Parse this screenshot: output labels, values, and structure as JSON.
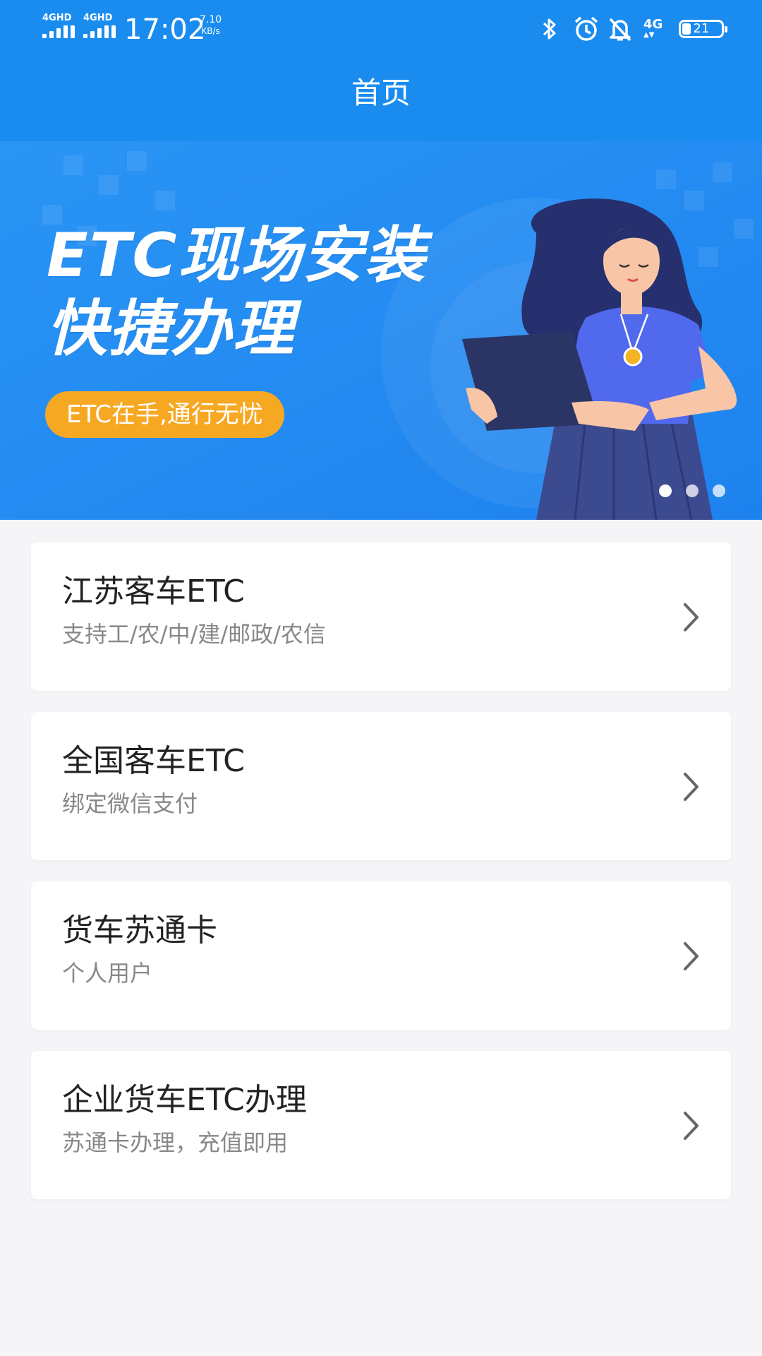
{
  "status_bar": {
    "signal1_label": "4GHD",
    "signal2_label": "4GHD",
    "time": "17:02",
    "net_speed_value": "7.10",
    "net_speed_unit": "KB/s",
    "net_type": "4G",
    "battery": "21",
    "icons": [
      "bluetooth-icon",
      "alarm-icon",
      "mute-icon",
      "4g-icon",
      "battery-icon"
    ]
  },
  "header": {
    "title": "首页"
  },
  "banner": {
    "headline_line1": "ETC现场安装",
    "headline_line2": "快捷办理",
    "tag": "ETC在手,通行无忧",
    "page_count": 3,
    "active_index": 0
  },
  "cards": [
    {
      "title": "江苏客车ETC",
      "subtitle": "支持工/农/中/建/邮政/农信"
    },
    {
      "title": "全国客车ETC",
      "subtitle": "绑定微信支付"
    },
    {
      "title": "货车苏通卡",
      "subtitle": "个人用户"
    },
    {
      "title": "企业货车ETC办理",
      "subtitle": "苏通卡办理，充值即用"
    }
  ],
  "colors": {
    "primary": "#1a8cf0",
    "tag": "#f7a823",
    "background": "#f5f5f7",
    "title_text": "#222222",
    "subtitle_text": "#888888"
  }
}
